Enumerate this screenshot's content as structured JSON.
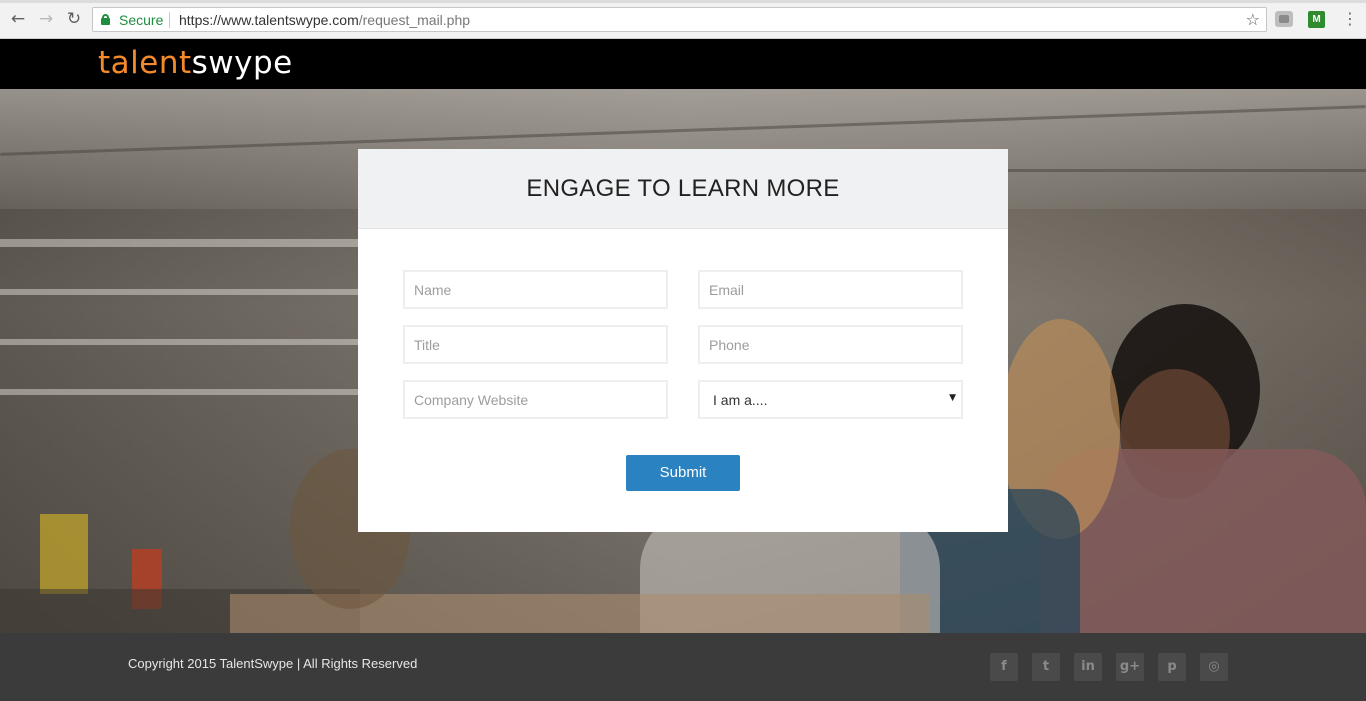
{
  "browser": {
    "secure_label": "Secure",
    "url_host": "https://www.talentswype.com",
    "url_path": "/request_mail.php",
    "back_icon": "arrow-left-icon",
    "forward_icon": "arrow-right-icon",
    "reload_icon": "reload-icon",
    "star_icon": "star-icon",
    "ext2_label": "M"
  },
  "site": {
    "logo_part1": "talent",
    "logo_part2": "swype",
    "logo_color_accent": "#f58a2a"
  },
  "form": {
    "title": "ENGAGE TO LEARN MORE",
    "name_placeholder": "Name",
    "email_placeholder": "Email",
    "title_placeholder": "Title",
    "phone_placeholder": "Phone",
    "website_placeholder": "Company Website",
    "role_selected": "I am a....",
    "submit_label": "Submit",
    "submit_color": "#2b82c0"
  },
  "footer": {
    "copyright": "Copyright 2015 TalentSwype | All Rights Reserved",
    "social": [
      {
        "icon": "facebook-icon",
        "glyph": "f"
      },
      {
        "icon": "twitter-icon",
        "glyph": "t"
      },
      {
        "icon": "linkedin-icon",
        "glyph": "in"
      },
      {
        "icon": "google-plus-icon",
        "glyph": "g+"
      },
      {
        "icon": "pinterest-icon",
        "glyph": "p"
      },
      {
        "icon": "dribbble-icon",
        "glyph": "◎"
      }
    ]
  }
}
